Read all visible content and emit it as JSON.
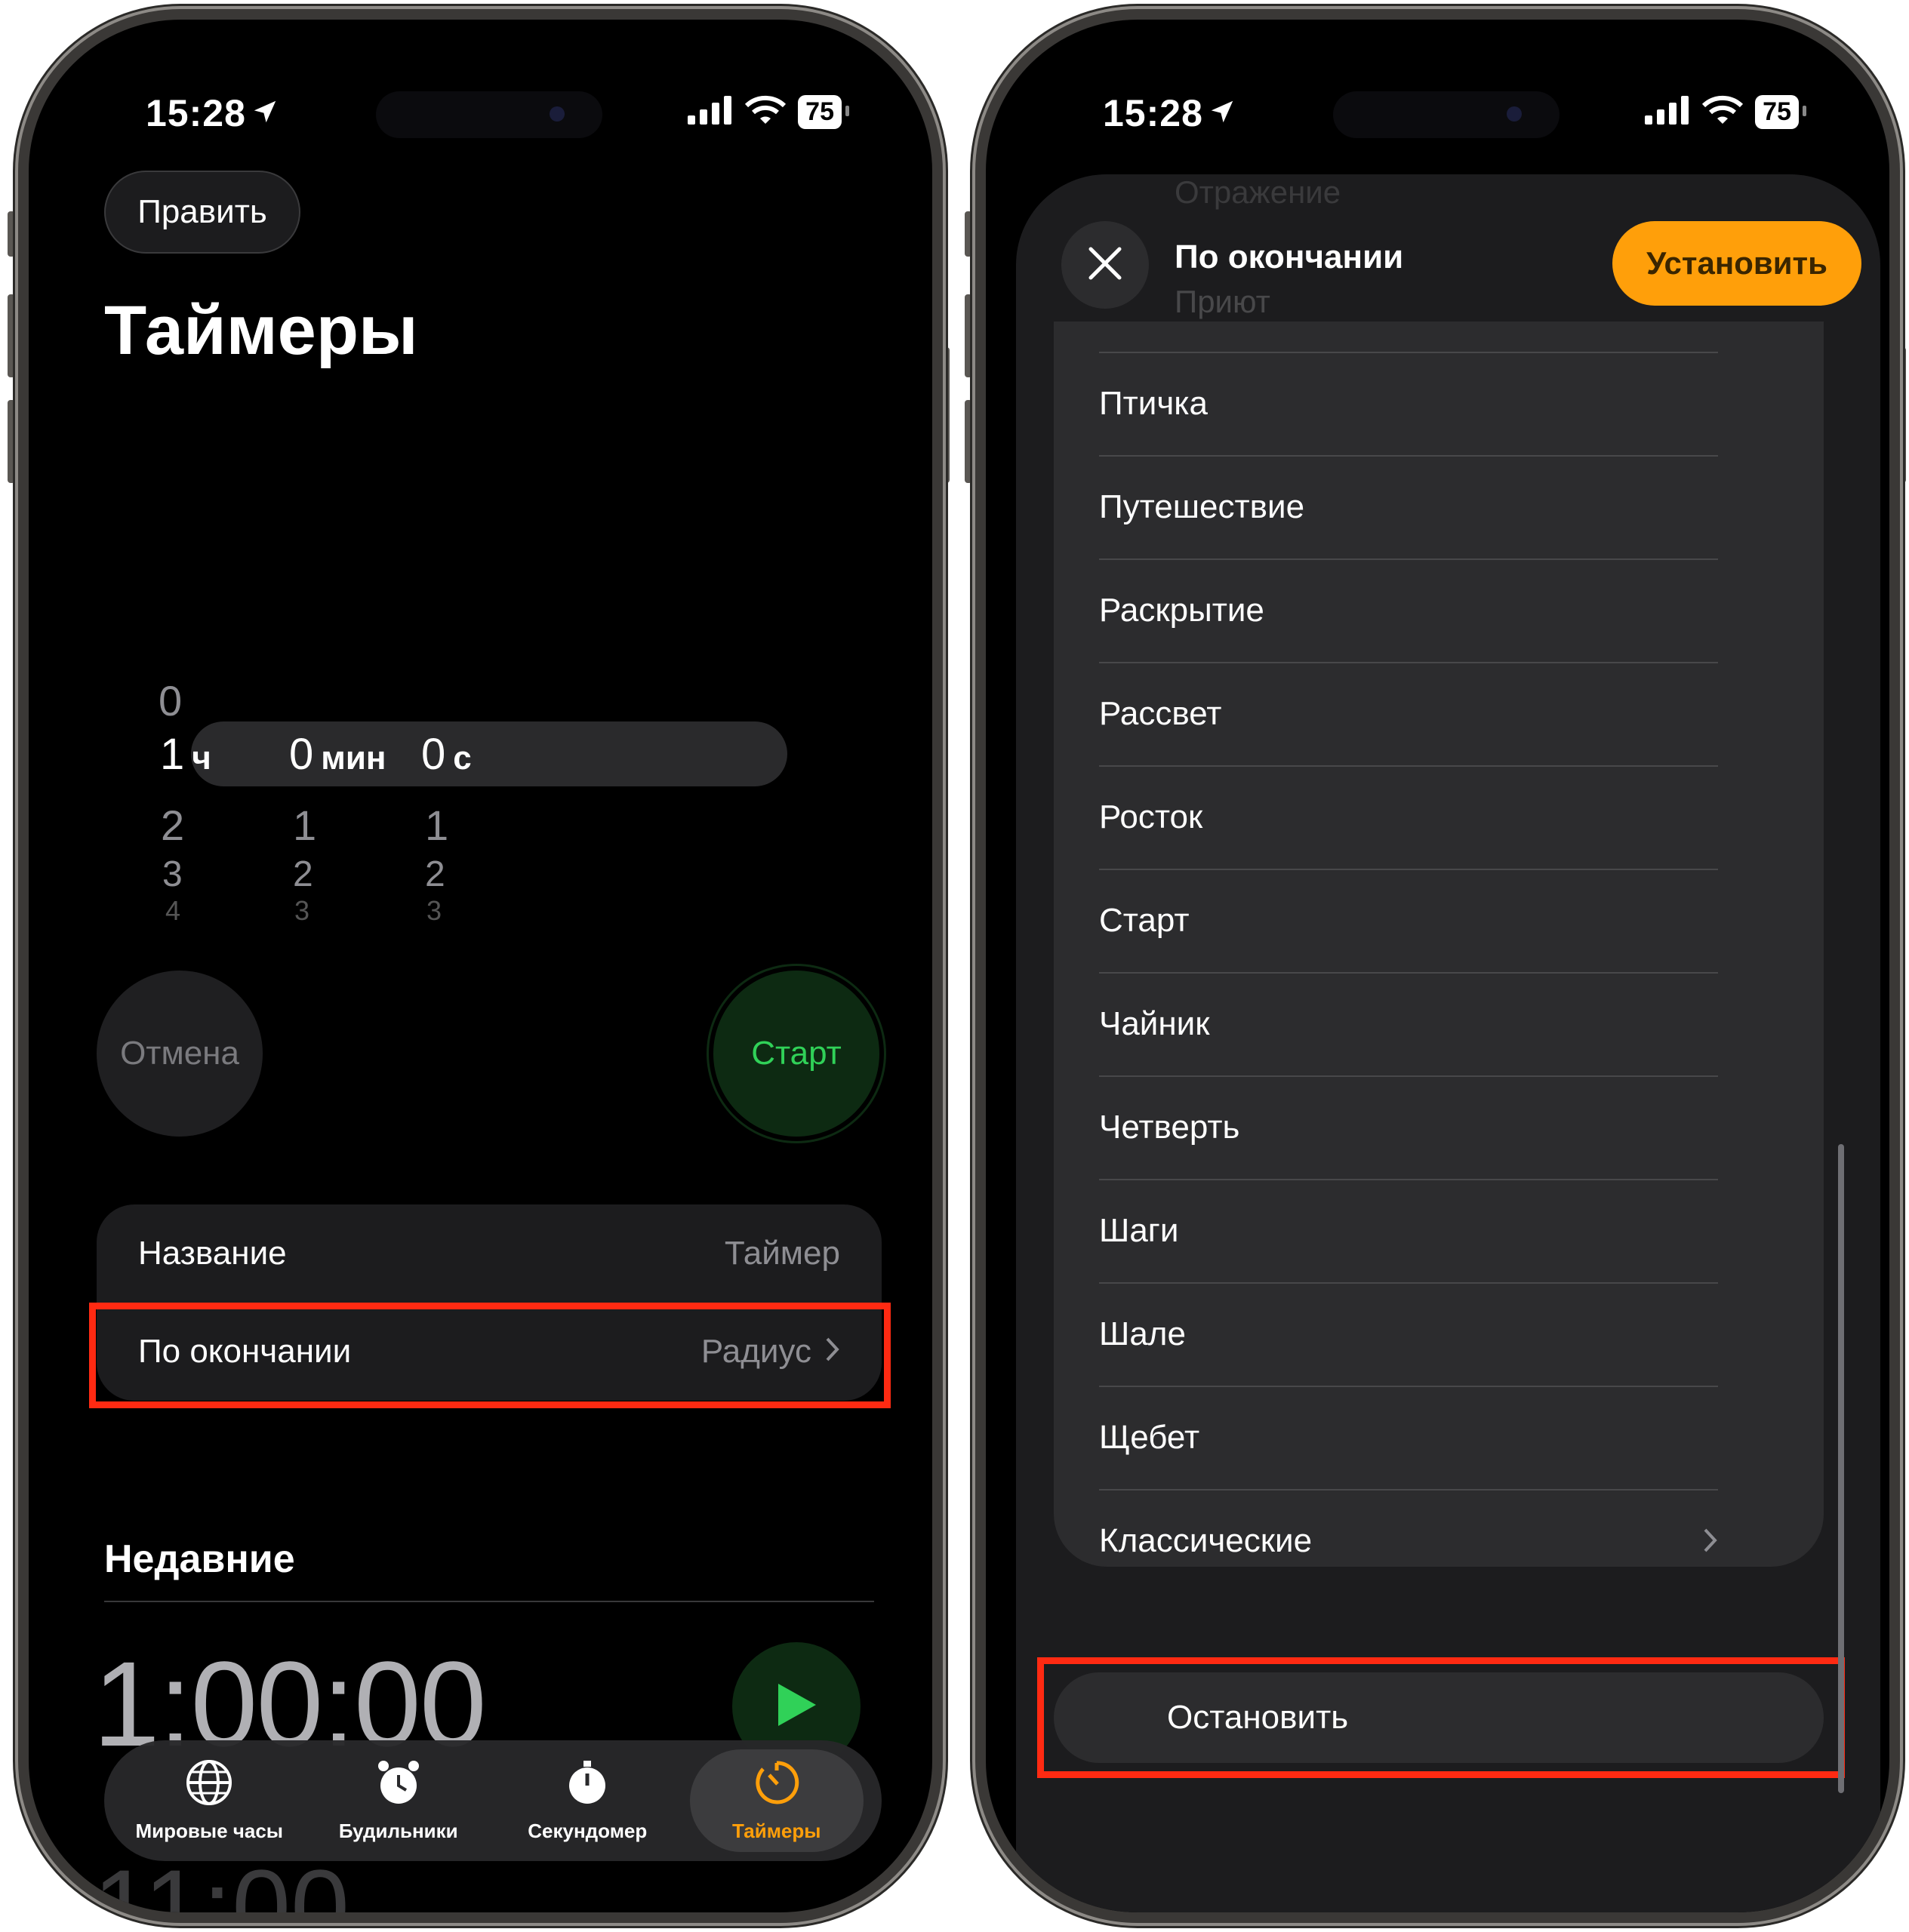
{
  "left_screen": {
    "status": {
      "time": "15:28",
      "battery": "75"
    },
    "edit_button": "Править",
    "title": "Таймеры",
    "picker": {
      "hours_above": "0",
      "hours": "1",
      "hours_unit": "ч",
      "minutes": "0",
      "minutes_unit": "мин",
      "seconds": "0",
      "seconds_unit": "с",
      "hours_below": [
        "2",
        "3",
        "4"
      ],
      "minutes_below": [
        "1",
        "2",
        "3"
      ],
      "seconds_below": [
        "1",
        "2",
        "3"
      ]
    },
    "cancel_button": "Отмена",
    "start_button": "Старт",
    "name_row": {
      "label": "Название",
      "value": "Таймер"
    },
    "end_row": {
      "label": "По окончании",
      "value": "Радиус"
    },
    "recent_title": "Недавние",
    "recent_time": "1:00:00",
    "recent_time_partial": "11:00",
    "tabs": [
      {
        "label": "Мировые часы",
        "icon": "globe-icon"
      },
      {
        "label": "Будильники",
        "icon": "alarm-icon"
      },
      {
        "label": "Секундомер",
        "icon": "stopwatch-icon"
      },
      {
        "label": "Таймеры",
        "icon": "timer-icon"
      }
    ],
    "colors": {
      "accent": "#ff9f0a",
      "start_green": "#30d158",
      "highlight": "#ff2a12"
    }
  },
  "right_screen": {
    "status": {
      "time": "15:28",
      "battery": "75"
    },
    "ghost_above": "Отражение",
    "sheet_title": "По окончании",
    "ghost_below": "Приют",
    "set_button": "Установить",
    "sounds": [
      "Птичка",
      "Путешествие",
      "Раскрытие",
      "Рассвет",
      "Росток",
      "Старт",
      "Чайник",
      "Четверть",
      "Шаги",
      "Шале",
      "Щебет",
      "Классические"
    ],
    "stop_option": "Остановить"
  }
}
